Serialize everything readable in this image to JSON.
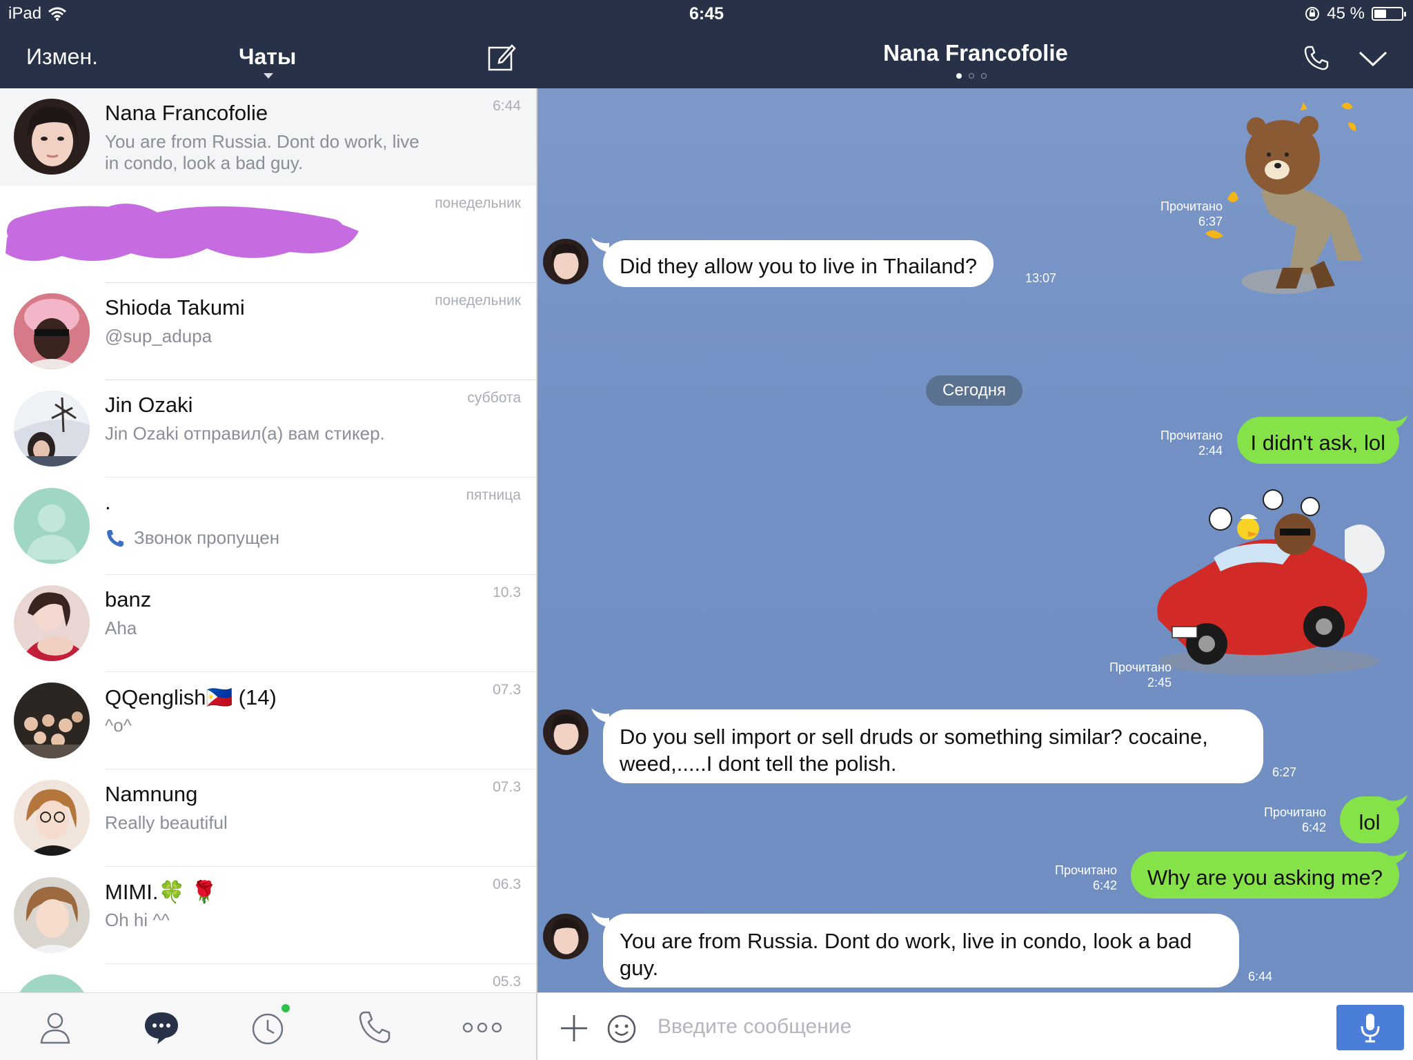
{
  "status_bar": {
    "device": "iPad",
    "time": "6:45",
    "battery": "45 %",
    "battery_level": 0.45
  },
  "left_header": {
    "edit_label": "Измен.",
    "title": "Чаты"
  },
  "chat": {
    "title": "Nana Francofolie"
  },
  "chats": [
    {
      "name": "Nana Francofolie",
      "preview": "You are from Russia. Dont do work, live in condo, look a bad guy.",
      "time": "6:44"
    },
    {
      "name": "",
      "preview": "",
      "time": "понедельник"
    },
    {
      "name": "Shioda Takumi",
      "preview": "@sup_adupa",
      "time": "понедельник"
    },
    {
      "name": "Jin Ozaki",
      "preview": "Jin Ozaki отправил(а) вам стикер.",
      "time": "суббота"
    },
    {
      "name": ".",
      "preview": "Звонок пропущен",
      "time": "пятница"
    },
    {
      "name": "banz",
      "preview": "Aha",
      "time": "10.3"
    },
    {
      "name": "QQenglish🇵🇭   (14)",
      "preview": "^o^",
      "time": "07.3"
    },
    {
      "name": "Namnung",
      "preview": "Really beautiful",
      "time": "07.3"
    },
    {
      "name": "MIMI.🍀 🌹",
      "preview": "Oh hi ^^",
      "time": "06.3"
    },
    {
      "name": "",
      "preview": "",
      "time": "05.3"
    }
  ],
  "messages": {
    "m1_sticker_read": "Прочитано",
    "m1_sticker_time": "6:37",
    "m2_text": "Did they allow you to live in Thailand?",
    "m2_time": "13:07",
    "date_divider": "Сегодня",
    "m3_text": "I didn't ask, lol",
    "m3_read": "Прочитано",
    "m3_time": "2:44",
    "m4_sticker_read": "Прочитано",
    "m4_sticker_time": "2:45",
    "m5_text": "Do you sell import or sell druds or something similar? cocaine, weed,.....I dont tell the polish.",
    "m5_time": "6:27",
    "m6_text": "lol",
    "m6_read": "Прочитано",
    "m6_time": "6:42",
    "m7_text": "Why are you asking me?",
    "m7_read": "Прочитано",
    "m7_time": "6:42",
    "m8_text": "You are from Russia. Dont do work, live in condo, look a bad guy.",
    "m8_time": "6:44"
  },
  "input": {
    "placeholder": "Введите сообщение"
  },
  "colors": {
    "header": "#273248",
    "bubble_out": "#85e249",
    "chat_bg": "#7290c4",
    "mic": "#4a7ed8",
    "redaction": "#c66ce0"
  },
  "icons": [
    "wifi-icon",
    "compose-icon",
    "phone-icon",
    "chevron-down-icon",
    "friends-icon",
    "chats-icon",
    "timeline-icon",
    "calls-icon",
    "more-icon",
    "plus-icon",
    "emoji-icon",
    "mic-icon",
    "missed-call-icon"
  ]
}
